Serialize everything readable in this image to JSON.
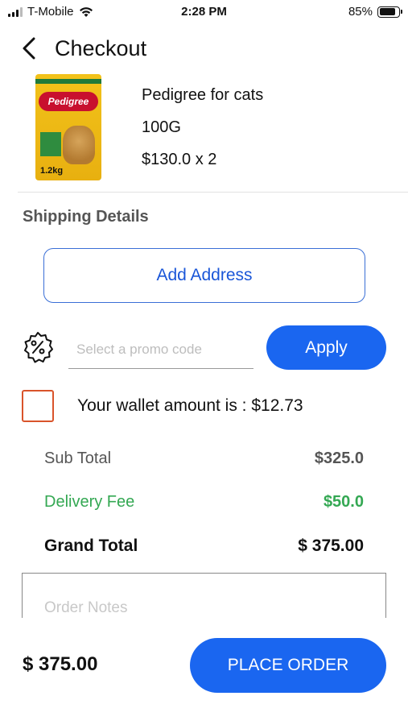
{
  "status_bar": {
    "carrier": "T-Mobile",
    "time": "2:28 PM",
    "battery_percent": "85%",
    "signal_bars": 3,
    "battery_level": 0.85
  },
  "header": {
    "title": "Checkout",
    "back_icon": "chevron-left-icon"
  },
  "product": {
    "name": "Pedigree for cats",
    "weight": "100G",
    "price_line": "$130.0 x 2",
    "image_brand": "Pedigree",
    "image_weight": "1.2kg"
  },
  "shipping": {
    "title": "Shipping Details",
    "add_address_label": "Add Address"
  },
  "promo": {
    "placeholder": "Select a promo code",
    "value": "",
    "apply_label": "Apply",
    "icon": "percent-badge-icon"
  },
  "wallet": {
    "text": "Your wallet amount is : $12.73",
    "checked": false
  },
  "totals": {
    "subtotal_label": "Sub Total",
    "subtotal_value": "$325.0",
    "delivery_label": "Delivery Fee",
    "delivery_value": "$50.0",
    "grand_label": "Grand Total",
    "grand_value": "$ 375.00"
  },
  "notes": {
    "placeholder": "Order Notes",
    "value": ""
  },
  "footer": {
    "total": "$ 375.00",
    "place_order_label": "PLACE ORDER"
  },
  "colors": {
    "primary_blue": "#1a66f0",
    "delivery_green": "#34a853",
    "wallet_checkbox": "#d9542b"
  }
}
